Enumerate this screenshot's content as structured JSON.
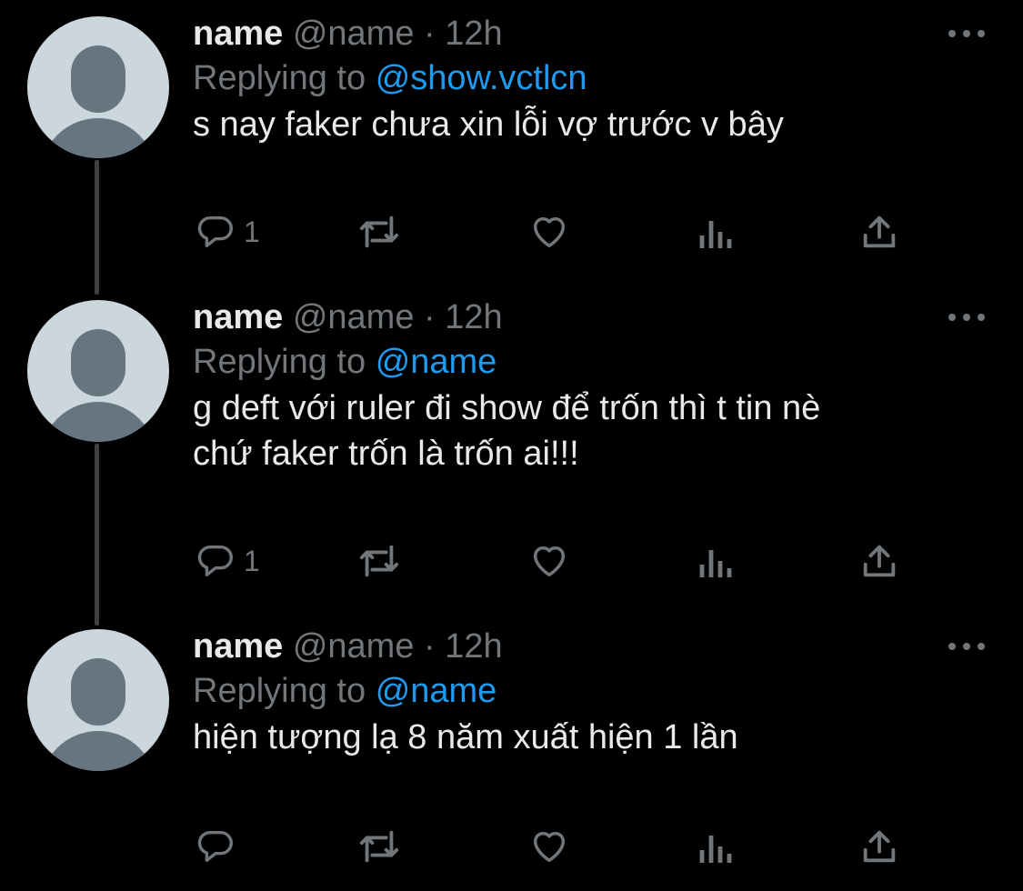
{
  "tweets": [
    {
      "display_name": "name",
      "handle": "@name",
      "separator": "·",
      "time": "12h",
      "replying_prefix": "Replying to",
      "replying_to": "@show.vctlcn",
      "lines": [
        "s nay faker chưa xin lỗi vợ trước v bây"
      ],
      "reply_count": "1",
      "icons": [
        "avatar-placeholder",
        "more-icon",
        "reply-icon",
        "retweet-icon",
        "like-icon",
        "analytics-icon",
        "share-icon"
      ]
    },
    {
      "display_name": "name",
      "handle": "@name",
      "separator": "·",
      "time": "12h",
      "replying_prefix": "Replying to",
      "replying_to": "@name",
      "lines": [
        "g deft với ruler đi show để trốn thì t tin nè",
        "chứ faker trốn là trốn ai!!!"
      ],
      "reply_count": "1",
      "icons": [
        "avatar-placeholder",
        "more-icon",
        "reply-icon",
        "retweet-icon",
        "like-icon",
        "analytics-icon",
        "share-icon"
      ]
    },
    {
      "display_name": "name",
      "handle": "@name",
      "separator": "·",
      "time": "12h",
      "replying_prefix": "Replying to",
      "replying_to": "@name",
      "lines": [
        "hiện tượng lạ 8 năm xuất hiện 1 lần"
      ],
      "reply_count": "",
      "icons": [
        "avatar-placeholder",
        "more-icon",
        "reply-icon",
        "retweet-icon",
        "like-icon",
        "analytics-icon",
        "share-icon"
      ]
    }
  ],
  "colors": {
    "background": "#000000",
    "primary_text": "#e7e9ea",
    "secondary_text": "#71767b",
    "link": "#1d9bf0",
    "thread_line": "#3e4144",
    "avatar_bg": "#ccd6dd",
    "avatar_fg": "#66757f"
  }
}
